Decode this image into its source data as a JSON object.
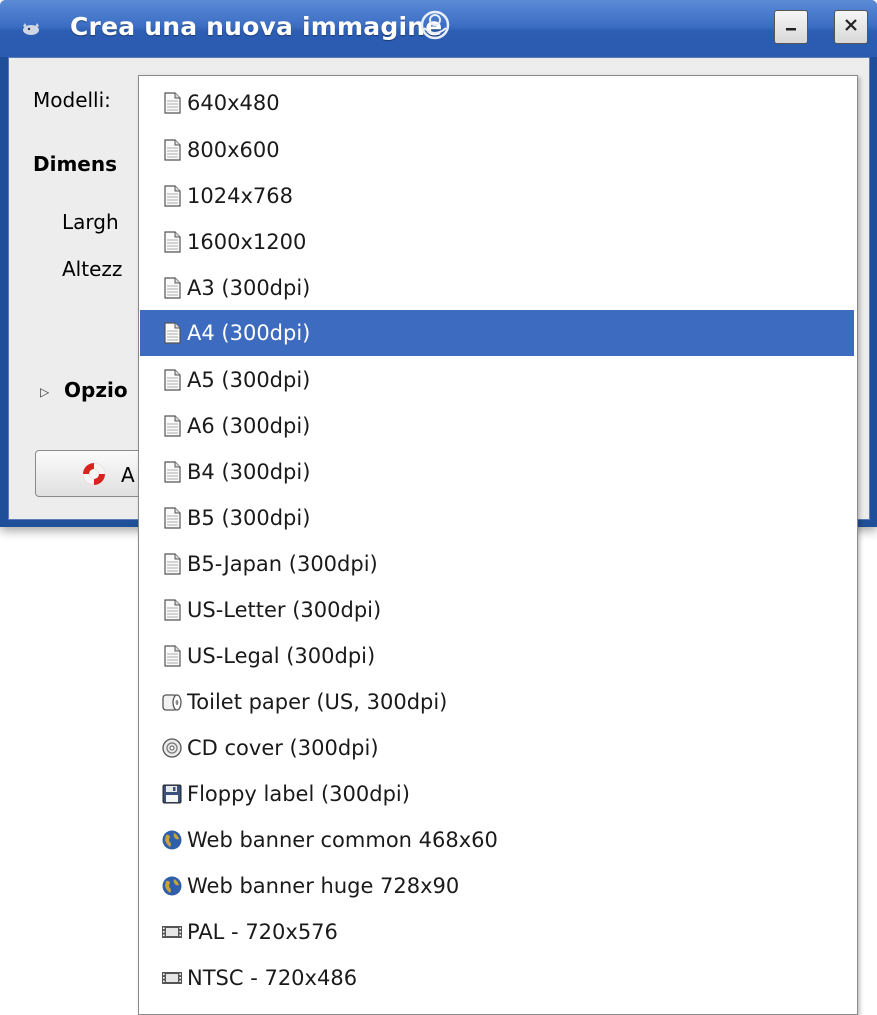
{
  "window": {
    "title": "Crea una nuova immagine",
    "app_icon": "gimp-icon",
    "minimize_icon": "minimize-icon",
    "close_icon": "close-icon",
    "busy_icon": "busy-indicator-icon"
  },
  "form": {
    "templates_label": "Modelli:",
    "dimensions_label": "Dimens",
    "width_label": "Largh",
    "height_label": "Altezz",
    "advanced_label": "Opzio",
    "help_button_label": "A"
  },
  "menu": {
    "items": [
      {
        "label": "640x480",
        "icon": "page-icon",
        "selected": false
      },
      {
        "label": "800x600",
        "icon": "page-icon",
        "selected": false
      },
      {
        "label": "1024x768",
        "icon": "page-icon",
        "selected": false
      },
      {
        "label": "1600x1200",
        "icon": "page-icon",
        "selected": false
      },
      {
        "label": "A3 (300dpi)",
        "icon": "page-icon",
        "selected": false
      },
      {
        "label": "A4 (300dpi)",
        "icon": "page-icon",
        "selected": true
      },
      {
        "label": "A5 (300dpi)",
        "icon": "page-icon",
        "selected": false
      },
      {
        "label": "A6 (300dpi)",
        "icon": "page-icon",
        "selected": false
      },
      {
        "label": "B4 (300dpi)",
        "icon": "page-icon",
        "selected": false
      },
      {
        "label": "B5 (300dpi)",
        "icon": "page-icon",
        "selected": false
      },
      {
        "label": "B5-Japan (300dpi)",
        "icon": "page-icon",
        "selected": false
      },
      {
        "label": "US-Letter (300dpi)",
        "icon": "page-icon",
        "selected": false
      },
      {
        "label": "US-Legal (300dpi)",
        "icon": "page-icon",
        "selected": false
      },
      {
        "label": "Toilet paper (US, 300dpi)",
        "icon": "toilet-paper-icon",
        "selected": false
      },
      {
        "label": "CD cover (300dpi)",
        "icon": "cd-icon",
        "selected": false
      },
      {
        "label": "Floppy label (300dpi)",
        "icon": "floppy-icon",
        "selected": false
      },
      {
        "label": "Web banner common 468x60",
        "icon": "globe-icon",
        "selected": false
      },
      {
        "label": "Web banner huge 728x90",
        "icon": "globe-icon",
        "selected": false
      },
      {
        "label": "PAL - 720x576",
        "icon": "film-icon",
        "selected": false
      },
      {
        "label": "NTSC - 720x486",
        "icon": "film-icon",
        "selected": false
      }
    ]
  },
  "colors": {
    "titlebar": "#3c6ec4",
    "selection": "#3d6bbf",
    "dialog_bg": "#ededed"
  }
}
